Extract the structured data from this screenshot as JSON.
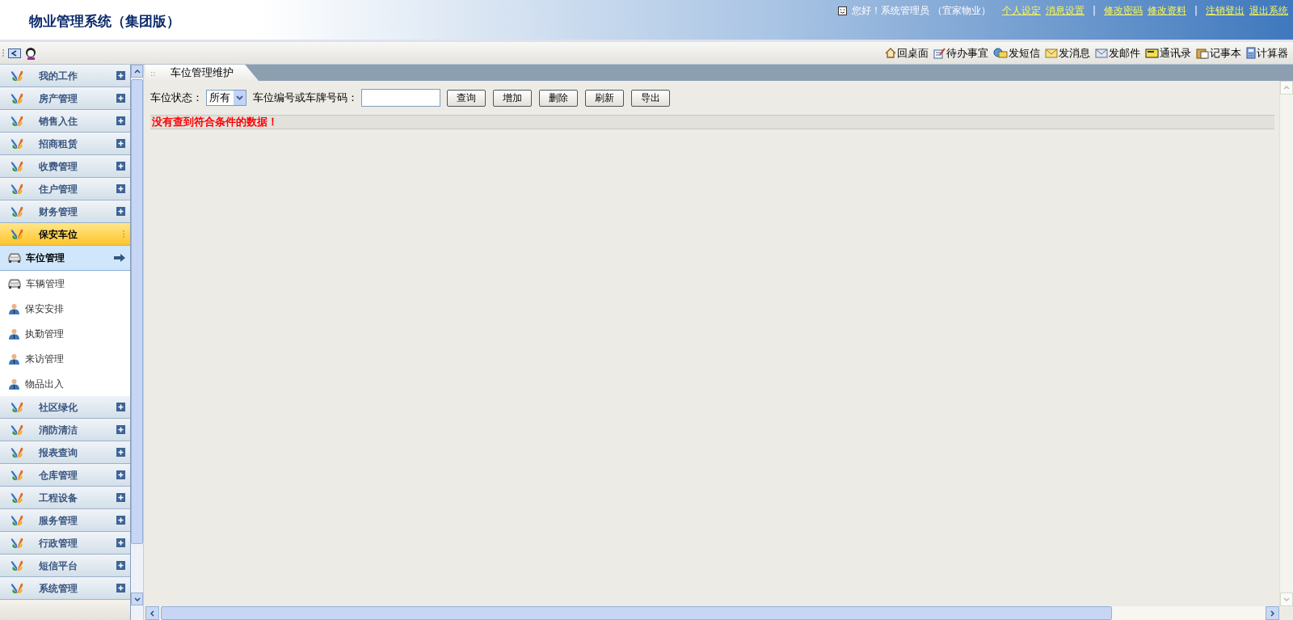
{
  "header": {
    "title": "物业管理系统（集团版）",
    "greeting": "您好！系统管理员 （宜家物业）",
    "links": [
      {
        "kind": "link",
        "label": "个人设定"
      },
      {
        "kind": "link",
        "label": "消息设置"
      },
      {
        "kind": "separator",
        "label": "|"
      },
      {
        "kind": "link",
        "label": "修改密码"
      },
      {
        "kind": "link",
        "label": "修改资料"
      },
      {
        "kind": "separator",
        "label": "|"
      },
      {
        "kind": "link",
        "label": "注销登出"
      },
      {
        "kind": "link",
        "label": "退出系统"
      }
    ]
  },
  "toolbar": {
    "items": [
      "回桌面",
      "待办事宜",
      "发短信",
      "发消息",
      "发邮件",
      "通讯录",
      "记事本",
      "计算器"
    ]
  },
  "sidebar": {
    "sections": [
      {
        "label": "我的工作",
        "expanded": false
      },
      {
        "label": "房产管理",
        "expanded": false
      },
      {
        "label": "销售入住",
        "expanded": false
      },
      {
        "label": "招商租赁",
        "expanded": false
      },
      {
        "label": "收费管理",
        "expanded": false
      },
      {
        "label": "住户管理",
        "expanded": false
      },
      {
        "label": "财务管理",
        "expanded": false
      },
      {
        "label": "保安车位",
        "expanded": true,
        "children": [
          {
            "label": "车位管理",
            "kind": "car",
            "selected": true
          },
          {
            "label": "车辆管理",
            "kind": "car",
            "selected": false
          },
          {
            "label": "保安安排",
            "kind": "person",
            "selected": false
          },
          {
            "label": "执勤管理",
            "kind": "person",
            "selected": false
          },
          {
            "label": "来访管理",
            "kind": "person",
            "selected": false
          },
          {
            "label": "物品出入",
            "kind": "person",
            "selected": false
          }
        ]
      },
      {
        "label": "社区绿化",
        "expanded": false
      },
      {
        "label": "消防清洁",
        "expanded": false
      },
      {
        "label": "报表查询",
        "expanded": false
      },
      {
        "label": "仓库管理",
        "expanded": false
      },
      {
        "label": "工程设备",
        "expanded": false
      },
      {
        "label": "服务管理",
        "expanded": false
      },
      {
        "label": "行政管理",
        "expanded": false
      },
      {
        "label": "短信平台",
        "expanded": false
      },
      {
        "label": "系统管理",
        "expanded": false
      }
    ]
  },
  "content": {
    "tab": {
      "grip": "::",
      "label": "车位管理维护"
    },
    "filter": {
      "status_label": "车位状态：",
      "status_value": "所有",
      "search_label": "车位编号或车牌号码：",
      "buttons": [
        "查询",
        "增加",
        "删除",
        "刷新",
        "导出"
      ]
    },
    "message": "没有查到符合条件的数据！"
  }
}
